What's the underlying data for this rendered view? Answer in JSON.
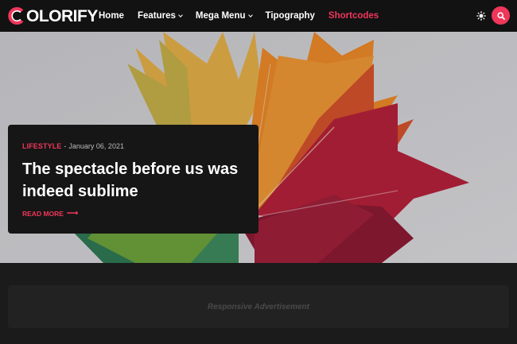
{
  "header": {
    "logo_text": "COLORIFY",
    "logo_letter_color": "#f0365a",
    "nav": [
      {
        "label": "Home",
        "has_dropdown": false,
        "active": false
      },
      {
        "label": "Features",
        "has_dropdown": true,
        "active": false
      },
      {
        "label": "Mega Menu",
        "has_dropdown": true,
        "active": false
      },
      {
        "label": "Tipography",
        "has_dropdown": false,
        "active": false
      },
      {
        "label": "Shortcodes",
        "has_dropdown": false,
        "active": true
      }
    ],
    "theme_toggle_icon": "sun-icon",
    "search_icon": "search-icon"
  },
  "featured": {
    "category": "LIFESTYLE",
    "separator": "-",
    "date": "January 06, 2021",
    "title": "The spectacle before us was indeed sublime",
    "read_more": "READ MORE",
    "read_more_icon": "arrow-right-icon"
  },
  "advertisement": {
    "label": "Responsive Advertisement"
  },
  "colors": {
    "accent": "#f0365a",
    "header_bg": "#121212",
    "page_bg": "#1b1b1b",
    "card_bg": "#161616"
  }
}
